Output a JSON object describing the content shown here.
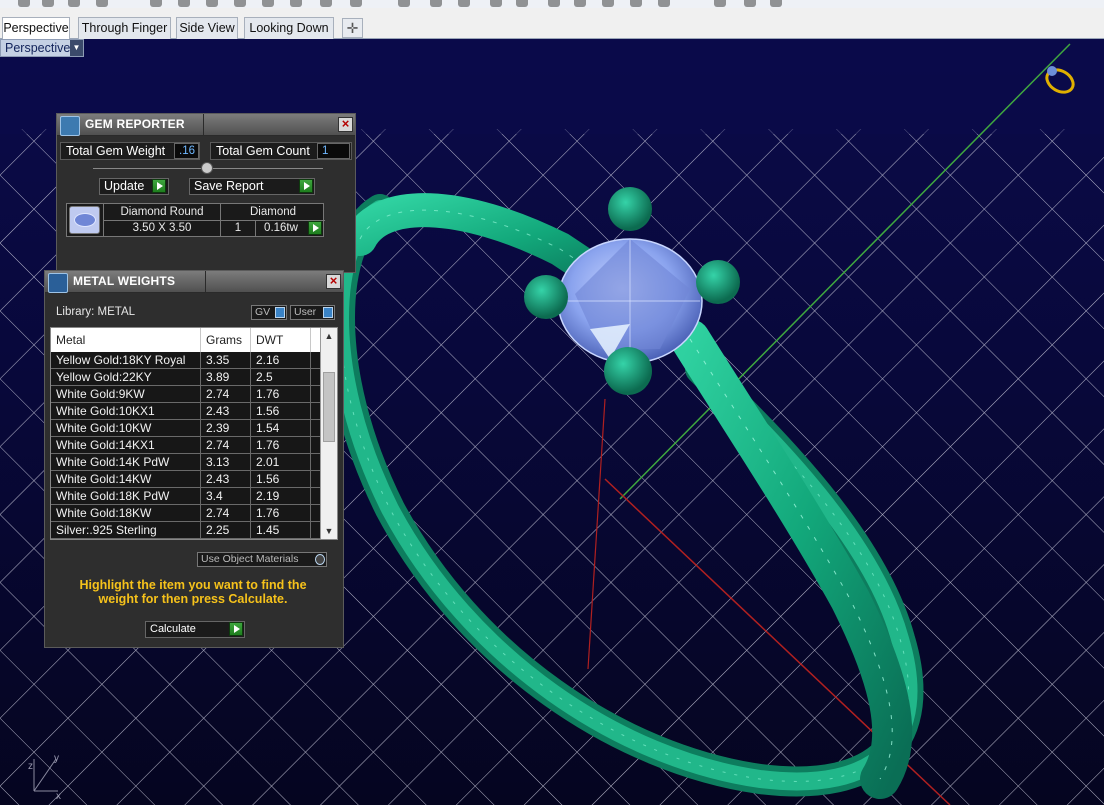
{
  "tabs": [
    {
      "label": "Perspective",
      "active": true
    },
    {
      "label": "Through Finger",
      "active": false
    },
    {
      "label": "Side View",
      "active": false
    },
    {
      "label": "Looking Down",
      "active": false
    }
  ],
  "tab_add_symbol": "✛",
  "viewport": {
    "label": "Perspective",
    "axis_labels": {
      "x": "x",
      "y": "y",
      "z": "z"
    }
  },
  "gem_reporter": {
    "title": "GEM REPORTER",
    "total_gem_weight_label": "Total Gem Weight",
    "total_gem_weight_value": ".16",
    "total_gem_count_label": "Total Gem Count",
    "total_gem_count_value": "1",
    "update_label": "Update",
    "save_report_label": "Save Report",
    "gem": {
      "shape": "Diamond Round",
      "type": "Diamond",
      "size": "3.50 X 3.50",
      "count": "1",
      "weight": "0.16tw"
    }
  },
  "metal_weights": {
    "title": "METAL WEIGHTS",
    "library_label": "Library: METAL",
    "gv_label": "GV",
    "user_label": "User",
    "columns": [
      "Metal",
      "Grams",
      "DWT"
    ],
    "rows": [
      {
        "metal": "Yellow Gold:18KY Royal",
        "grams": "3.35",
        "dwt": "2.16"
      },
      {
        "metal": "Yellow Gold:22KY",
        "grams": "3.89",
        "dwt": "2.5"
      },
      {
        "metal": "White Gold:9KW",
        "grams": "2.74",
        "dwt": "1.76"
      },
      {
        "metal": "White Gold:10KX1",
        "grams": "2.43",
        "dwt": "1.56"
      },
      {
        "metal": "White Gold:10KW",
        "grams": "2.39",
        "dwt": "1.54"
      },
      {
        "metal": "White Gold:14KX1",
        "grams": "2.74",
        "dwt": "1.76"
      },
      {
        "metal": "White Gold:14K PdW",
        "grams": "3.13",
        "dwt": "2.01"
      },
      {
        "metal": "White Gold:14KW",
        "grams": "2.43",
        "dwt": "1.56"
      },
      {
        "metal": "White Gold:18K PdW",
        "grams": "3.4",
        "dwt": "2.19"
      },
      {
        "metal": "White Gold:18KW",
        "grams": "2.74",
        "dwt": "1.76"
      },
      {
        "metal": "Silver:.925 Sterling",
        "grams": "2.25",
        "dwt": "1.45"
      }
    ],
    "use_object_materials_label": "Use Object Materials",
    "hint": "Highlight the item you want to find the weight for then press Calculate.",
    "calculate_label": "Calculate"
  },
  "colors": {
    "viewport_bg": "#0a0a3c",
    "grid": "#d9d9e8",
    "ring": "#12a77a",
    "gem": "#8aa3ee",
    "hint": "#f6c21b"
  }
}
